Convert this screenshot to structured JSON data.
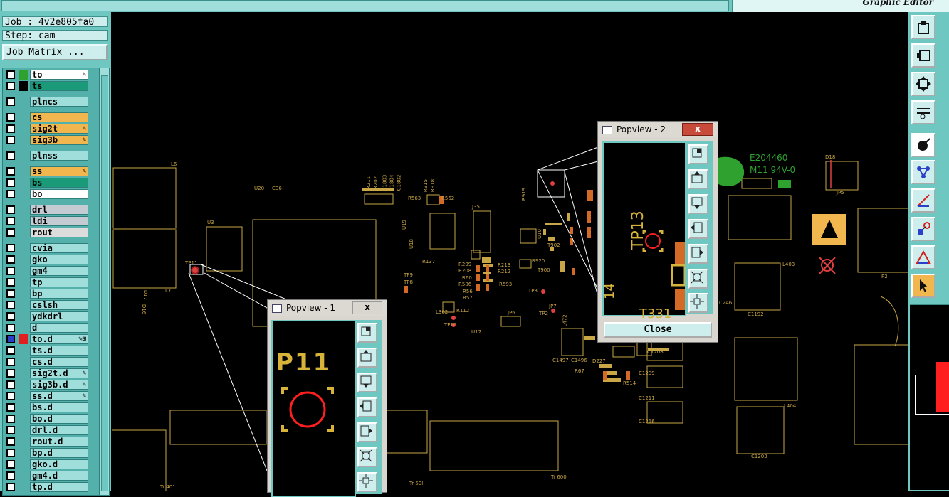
{
  "header": {
    "title_field": "",
    "logo": "",
    "brand": "Graphic Editor"
  },
  "job": {
    "job_line": "Job : 4v2e805fa0",
    "step_line": "Step: cam",
    "matrix_button": "Job Matrix ..."
  },
  "layers": [
    {
      "name": "to",
      "bg": "#ffffff",
      "swatch": "#2fa12f",
      "mark": "pen"
    },
    {
      "name": "ts",
      "bg": "#1a9a78",
      "swatch": "#000000",
      "mark": ""
    },
    {
      "name": "plncs",
      "bg": "#9fdedb",
      "swatch": "",
      "mark": "",
      "gap": true
    },
    {
      "name": "cs",
      "bg": "#f2b64f",
      "swatch": "",
      "mark": "",
      "gap": true
    },
    {
      "name": "sig2t",
      "bg": "#f2b64f",
      "swatch": "",
      "mark": "pen"
    },
    {
      "name": "sig3b",
      "bg": "#f2b64f",
      "swatch": "",
      "mark": "pen"
    },
    {
      "name": "plnss",
      "bg": "#9fdedb",
      "swatch": "",
      "mark": "",
      "gap": true
    },
    {
      "name": "ss",
      "bg": "#f2b64f",
      "swatch": "",
      "mark": "pen",
      "gap": true
    },
    {
      "name": "bs",
      "bg": "#1a9a78",
      "swatch": "",
      "mark": ""
    },
    {
      "name": "bo",
      "bg": "#ffffff",
      "swatch": "",
      "mark": ""
    },
    {
      "name": "drl",
      "bg": "#c4cbd2",
      "swatch": "",
      "mark": "",
      "gap": true
    },
    {
      "name": "ldi",
      "bg": "#c4cbd2",
      "swatch": "",
      "mark": ""
    },
    {
      "name": "rout",
      "bg": "#dcdcdc",
      "swatch": "",
      "mark": ""
    },
    {
      "name": "cvia",
      "bg": "#9fdedb",
      "swatch": "",
      "mark": "",
      "gap": true
    },
    {
      "name": "gko",
      "bg": "#9fdedb",
      "swatch": "",
      "mark": ""
    },
    {
      "name": "gm4",
      "bg": "#9fdedb",
      "swatch": "",
      "mark": ""
    },
    {
      "name": "tp",
      "bg": "#9fdedb",
      "swatch": "",
      "mark": ""
    },
    {
      "name": "bp",
      "bg": "#9fdedb",
      "swatch": "",
      "mark": ""
    },
    {
      "name": "cslsh",
      "bg": "#9fdedb",
      "swatch": "",
      "mark": ""
    },
    {
      "name": "ydkdrl",
      "bg": "#9fdedb",
      "swatch": "",
      "mark": ""
    },
    {
      "name": "d",
      "bg": "#9fdedb",
      "swatch": "",
      "mark": ""
    },
    {
      "name": "to.d",
      "bg": "#9fdedb",
      "swatch": "#e02020",
      "mark": "pen-grid",
      "active": true
    },
    {
      "name": "ts.d",
      "bg": "#9fdedb",
      "swatch": "",
      "mark": ""
    },
    {
      "name": "cs.d",
      "bg": "#9fdedb",
      "swatch": "",
      "mark": ""
    },
    {
      "name": "sig2t.d",
      "bg": "#9fdedb",
      "swatch": "",
      "mark": "pen"
    },
    {
      "name": "sig3b.d",
      "bg": "#9fdedb",
      "swatch": "",
      "mark": "pen"
    },
    {
      "name": "ss.d",
      "bg": "#9fdedb",
      "swatch": "",
      "mark": "pen"
    },
    {
      "name": "bs.d",
      "bg": "#9fdedb",
      "swatch": "",
      "mark": ""
    },
    {
      "name": "bo.d",
      "bg": "#9fdedb",
      "swatch": "",
      "mark": ""
    },
    {
      "name": "drl.d",
      "bg": "#9fdedb",
      "swatch": "",
      "mark": ""
    },
    {
      "name": "rout.d",
      "bg": "#9fdedb",
      "swatch": "",
      "mark": ""
    },
    {
      "name": "bp.d",
      "bg": "#9fdedb",
      "swatch": "",
      "mark": ""
    },
    {
      "name": "gko.d",
      "bg": "#9fdedb",
      "swatch": "",
      "mark": ""
    },
    {
      "name": "gm4.d",
      "bg": "#9fdedb",
      "swatch": "",
      "mark": ""
    },
    {
      "name": "tp.d",
      "bg": "#9fdedb",
      "swatch": "",
      "mark": ""
    }
  ],
  "popview1": {
    "title": "Popview - 1",
    "close_x": "x",
    "pad_label": "P11"
  },
  "popview2": {
    "title": "Popview - 2",
    "close_x": "x",
    "pad_label": "TP13",
    "close_button": "Close",
    "frag1": "14",
    "frag2": "T331"
  },
  "board_labels": {
    "l_l6": "L6",
    "l_l7": "L7",
    "l_u20": "U20",
    "l_c36": "C36",
    "l_u3": "U3",
    "l_tp11": "TP11",
    "l_d17": "D17",
    "l_d16": "D16",
    "l_r211": "R211",
    "l_r202": "R202",
    "l_c1803": "C1803",
    "l_c1804": "C1804",
    "l_c1802": "C1802",
    "l_r563": "R563",
    "l_r562": "R562",
    "l_r915": "R915",
    "l_r918": "R918",
    "l_j35": "J35",
    "l_u19": "U19",
    "l_u18": "U18",
    "l_r919": "R919",
    "l_r137": "R137",
    "l_r209": "R209",
    "l_r208": "R208",
    "l_r213": "R213",
    "l_r212": "R212",
    "l_r60": "R60",
    "l_r586": "R586",
    "l_r593": "R593",
    "l_r56": "R56",
    "l_r57": "R57",
    "l_tp9": "TP9",
    "l_tp8": "TP8",
    "l_l302": "L302",
    "l_r112": "R112",
    "l_tp10": "TP10",
    "l_u17": "U17",
    "l_jp6": "JP6",
    "l_r920": "R920",
    "l_t900": "T900",
    "l_tp3": "TP3",
    "l_tp2": "TP2",
    "l_jp7": "JP7",
    "l_u10": "U10",
    "l_t902": "T902",
    "l_l472": "L472",
    "l_c1497": "C1497",
    "l_c1496": "C1496",
    "l_d227": "D227",
    "l_r67": "R67",
    "l_r514": "R514",
    "l_c1209": "C1209",
    "l_c1211": "C1211",
    "l_c1216": "C1216",
    "l_c1208": "C1208",
    "l_e204460": "E204460",
    "l_m11": "M11 94V-0",
    "l_d18": "D18",
    "l_jp5": "JP5",
    "l_l403": "L403",
    "l_c1192": "C1192",
    "l_p2": "P2",
    "l_l404": "L404",
    "l_c1203": "C1203",
    "l_tr401": "Tr 401",
    "l_tr501": "Tr 50l",
    "l_tr600": "Tr 600",
    "l_c246": "C246"
  }
}
